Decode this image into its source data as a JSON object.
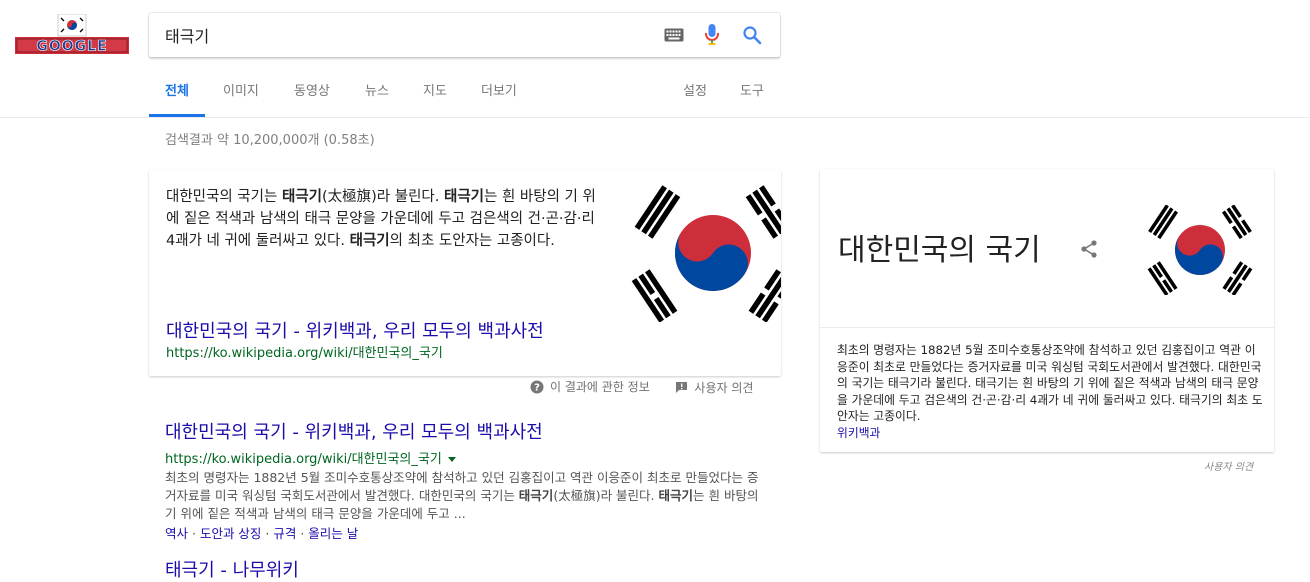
{
  "colors": {
    "link": "#1a0dab",
    "url": "#006621",
    "accent": "#1a73e8",
    "flag_red": "#cd2e3a",
    "flag_blue": "#0047a0"
  },
  "logo": {
    "text": "GOOGLE"
  },
  "search": {
    "query": "태극기",
    "keyboard_icon": "keyboard-icon",
    "mic_icon": "mic-icon",
    "search_icon": "search-icon"
  },
  "tabs": [
    {
      "label": "전체",
      "active": true
    },
    {
      "label": "이미지"
    },
    {
      "label": "동영상"
    },
    {
      "label": "뉴스"
    },
    {
      "label": "지도"
    },
    {
      "label": "더보기"
    },
    {
      "label": "설정"
    },
    {
      "label": "도구"
    }
  ],
  "result_stats": "검색결과 약 10,200,000개 (0.58초)",
  "snippet": {
    "text_parts": [
      {
        "t": "대한민국의 국기는 "
      },
      {
        "t": "태극기",
        "b": true
      },
      {
        "t": "(太極旗)라 불린다. "
      },
      {
        "t": "태극기",
        "b": true
      },
      {
        "t": "는 흰 바탕의 기 위에 짙은 적색과 남색의 태극 문양을 가운데에 두고 검은색의 건·곤·감·리 4괘가 네 귀에 둘러싸고 있다. "
      },
      {
        "t": "태극기",
        "b": true
      },
      {
        "t": "의 최초 도안자는 고종이다."
      }
    ],
    "title": "대한민국의 국기 - 위키백과, 우리 모두의 백과사전",
    "url": "https://ko.wikipedia.org/wiki/대한민국의_국기"
  },
  "snippet_footer": {
    "about_label": "이 결과에 관한 정보",
    "feedback_label": "사용자 의견"
  },
  "result1": {
    "title": "대한민국의 국기 - 위키백과, 우리 모두의 백과사전",
    "url": "https://ko.wikipedia.org/wiki/대한민국의_국기",
    "desc_parts": [
      {
        "t": "최초의 명령자는 1882년 5월 조미수호통상조약에 참석하고 있던 김홍집이고 역관 이응준이 최초로 만들었다는 증거자료를 미국 워싱텀 국회도서관에서 발견했다. 대한민국의 국기는 "
      },
      {
        "t": "태극기",
        "b": true
      },
      {
        "t": "(太極旗)라 불린다. "
      },
      {
        "t": "태극기",
        "b": true
      },
      {
        "t": "는 흰 바탕의 기 위에 짙은 적색과 남색의 태극 문양을 가운데에 두고 ..."
      }
    ],
    "sitelinks": [
      "역사",
      "도안과 상징",
      "규격",
      "올리는 날"
    ],
    "sitelink_sep": " · "
  },
  "result2": {
    "title": "태극기 - 나무위키"
  },
  "knowledge_panel": {
    "title": "대한민국의 국기",
    "share_icon": "share-icon",
    "description": "최초의 명령자는 1882년 5월 조미수호통상조약에 참석하고 있던 김홍집이고 역관 이응준이 최초로 만들었다는 증거자료를 미국 워싱텀 국회도서관에서 발견했다. 대한민국의 국기는 태극기라 불린다. 태극기는 흰 바탕의 기 위에 짙은 적색과 남색의 태극 문양을 가운데에 두고 검은색의 건·곤·감·리 4괘가 네 귀에 둘러싸고 있다. 태극기의 최초 도안자는 고종이다.",
    "source": "위키백과",
    "feedback": "사용자 의견"
  }
}
